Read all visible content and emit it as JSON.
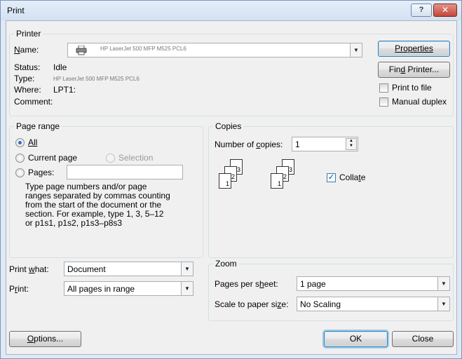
{
  "window": {
    "title": "Print",
    "help_label": "?",
    "close_label": "✕"
  },
  "printer": {
    "group_label": "Printer",
    "name_label": "Name:",
    "name_value": "HP LaserJet 500 MFP M525 PCL6",
    "status_label": "Status:",
    "status_value": "Idle",
    "type_label": "Type:",
    "type_value": "HP LaserJet 500 MFP M525 PCL6",
    "where_label": "Where:",
    "where_value": "LPT1:",
    "comment_label": "Comment:",
    "properties_label": "Properties",
    "find_printer_label": "Find Printer...",
    "print_to_file_label": "Print to file",
    "manual_duplex_label": "Manual duplex"
  },
  "page_range": {
    "group_label": "Page range",
    "all_label": "All",
    "current_page_label": "Current page",
    "selection_label": "Selection",
    "pages_label": "Pages:",
    "pages_value": "",
    "description": "Type page numbers and/or page\nranges separated by commas counting\nfrom the start of the document or the\nsection. For example, type 1, 3, 5–12\nor p1s1, p1s2, p1s3–p8s3"
  },
  "copies": {
    "group_label": "Copies",
    "number_label": "Number of copies:",
    "number_value": "1",
    "collate_label": "Collate",
    "collate_checked": true,
    "sheet_numbers": [
      "1",
      "2",
      "3"
    ]
  },
  "print_what": {
    "label": "Print what:",
    "value": "Document"
  },
  "print": {
    "label": "Print:",
    "value": "All pages in range"
  },
  "zoom": {
    "group_label": "Zoom",
    "pages_per_sheet_label": "Pages per sheet:",
    "pages_per_sheet_value": "1 page",
    "scale_label": "Scale to paper size:",
    "scale_value": "No Scaling"
  },
  "footer": {
    "options_label": "Options...",
    "ok_label": "OK",
    "close_label": "Close"
  },
  "icons": {
    "dropdown": "chevron-down-icon",
    "printer": "printer-icon"
  }
}
